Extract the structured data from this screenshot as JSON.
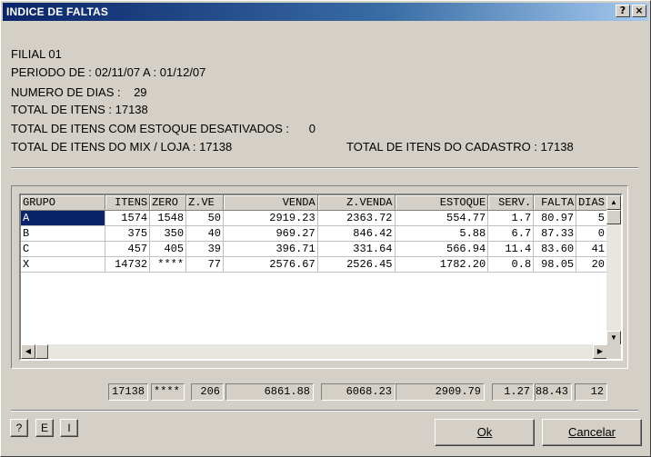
{
  "window": {
    "title": "INDICE DE FALTAS",
    "help_button": "?",
    "close_button": "×"
  },
  "info": {
    "filial": "FILIAL 01",
    "periodo": "PERIODO DE : 02/11/07 A : 01/12/07",
    "numero_dias": "NUMERO DE DIAS :    29",
    "total_itens": "TOTAL DE ITENS : 17138",
    "total_desativados": "TOTAL DE ITENS COM ESTOQUE DESATIVADOS :      0",
    "total_mix": "TOTAL DE ITENS DO MIX / LOJA : 17138",
    "total_cadastro": "TOTAL DE ITENS DO CADASTRO : 17138"
  },
  "grid": {
    "columns": [
      "GRUPO",
      "ITENS",
      "ZERO",
      "Z.VE",
      "VENDA",
      "Z.VENDA",
      "ESTOQUE",
      "SERV.",
      "FALTA",
      "DIAS"
    ],
    "rows": [
      [
        "A",
        "1574",
        "1548",
        "50",
        "2919.23",
        "2363.72",
        "554.77",
        "1.7",
        "80.97",
        "5"
      ],
      [
        "B",
        "375",
        "350",
        "40",
        "969.27",
        "846.42",
        "5.88",
        "6.7",
        "87.33",
        "0"
      ],
      [
        "C",
        "457",
        "405",
        "39",
        "396.71",
        "331.64",
        "566.94",
        "11.4",
        "83.60",
        "41"
      ],
      [
        "X",
        "14732",
        "****",
        "77",
        "2576.67",
        "2526.45",
        "1782.20",
        "0.8",
        "98.05",
        "20"
      ]
    ],
    "selected_row": 0
  },
  "totals": {
    "itens": "17138",
    "zero": "****",
    "zve": "206",
    "venda": "6861.88",
    "zvenda": "6068.23",
    "estoque": "2909.79",
    "serv": "1.27",
    "falta": "88.43",
    "dias": "12"
  },
  "buttons": {
    "help": "?",
    "e": "E",
    "i": "I",
    "ok": "Ok",
    "cancel": "Cancelar"
  },
  "colors": {
    "title_bar": "#0a246a",
    "face": "#d4d0c8",
    "selection": "#0a246a"
  }
}
